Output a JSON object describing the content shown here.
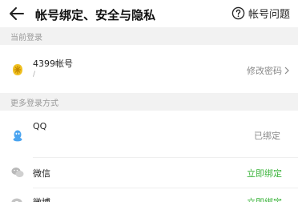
{
  "header": {
    "title": "帐号绑定、安全与隐私",
    "help_label": "帐号问题"
  },
  "current_login": {
    "section_label": "当前登录",
    "account_name": "4399帐号",
    "account_sub": "/",
    "action_label": "修改密码"
  },
  "more_methods": {
    "section_label": "更多登录方式",
    "items": [
      {
        "name": "QQ",
        "status": "已绑定",
        "icon": "qq-icon"
      },
      {
        "name": "微信",
        "status": "立即绑定",
        "icon": "wechat-icon"
      },
      {
        "name": "微博",
        "status": "立即绑定",
        "icon": "weibo-icon"
      }
    ]
  },
  "colors": {
    "accent_green": "#3cb43c",
    "section_bg": "#f2f2f2",
    "qq_blue": "#4aa4f0",
    "logo_yellow": "#f0c020"
  }
}
